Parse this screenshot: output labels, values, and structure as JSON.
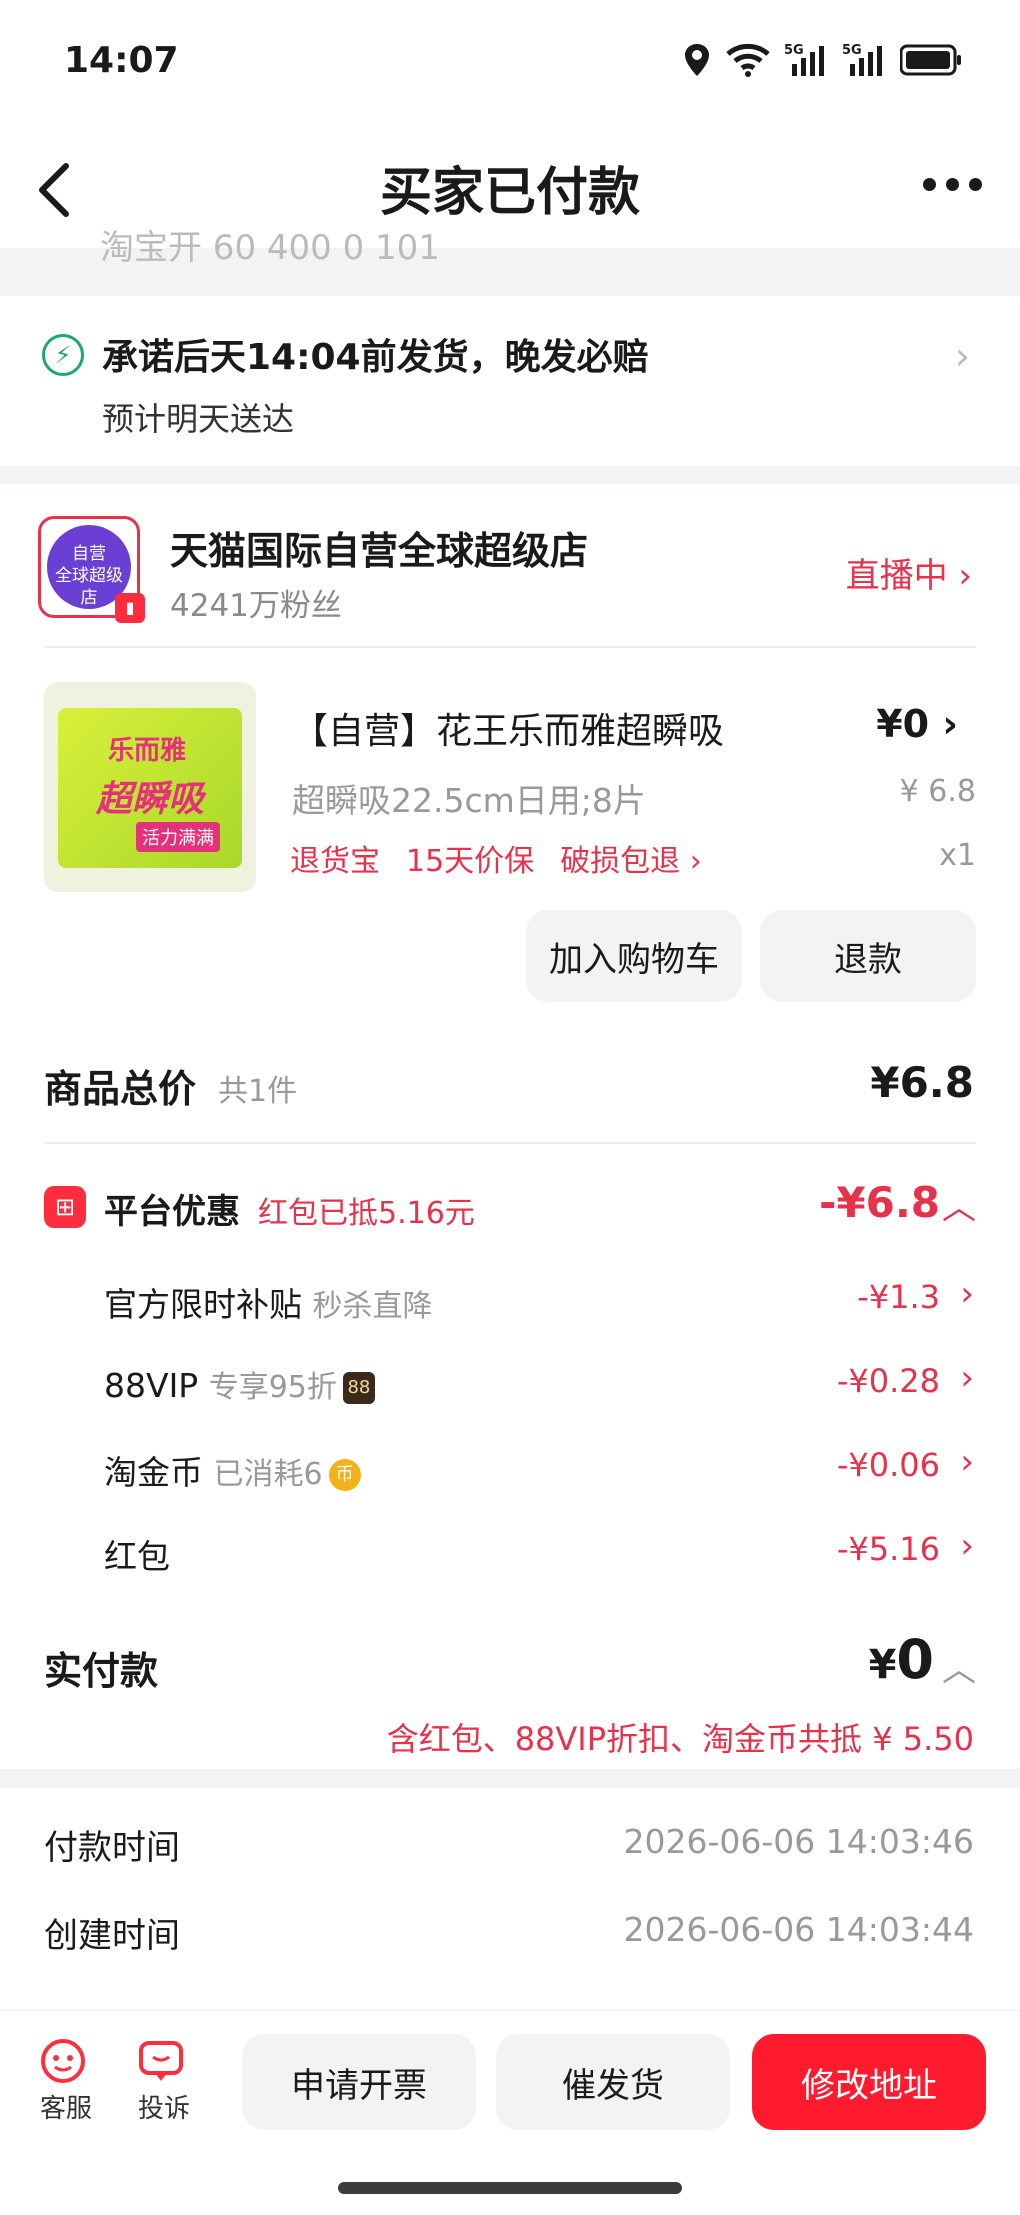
{
  "status_bar": {
    "time": "14:07"
  },
  "nav": {
    "title": "买家已付款"
  },
  "faded_header": "淘宝开 60 400    0 101",
  "shipping": {
    "title": "承诺后天14:04前发货，晚发必赔",
    "subtitle": "预计明天送达"
  },
  "shop": {
    "logo_line1": "自营",
    "logo_line2": "全球超级店",
    "name": "天猫国际自营全球超级店",
    "fans": "4241万粉丝",
    "live": "直播中"
  },
  "product": {
    "pkg_brand": "乐而雅",
    "pkg_name": "超瞬吸",
    "pkg_tag": "活力满满",
    "title": "【自营】花王乐而雅超瞬吸",
    "price": "¥0",
    "spec": "超瞬吸22.5cm日用;8片",
    "original_price": "¥ 6.8",
    "tags": [
      "退货宝",
      "15天价保",
      "破损包退"
    ],
    "qty": "x1",
    "btn_cart": "加入购物车",
    "btn_refund": "退款"
  },
  "summary": {
    "total_label": "商品总价",
    "total_count": "共1件",
    "total_value": "¥6.8",
    "promo_label": "平台优惠",
    "promo_sub": "红包已抵5.16元",
    "promo_value": "-¥6.8",
    "discounts": [
      {
        "label": "官方限时补贴",
        "note": "秒杀直降",
        "value": "-¥1.3",
        "badge": ""
      },
      {
        "label": "88VIP",
        "note": "专享95折",
        "value": "-¥0.28",
        "badge": "88"
      },
      {
        "label": "淘金币",
        "note": "已消耗6",
        "value": "-¥0.06",
        "badge": "币"
      },
      {
        "label": "红包",
        "note": "",
        "value": "-¥5.16",
        "badge": ""
      }
    ],
    "paid_label": "实付款",
    "paid_currency": "¥",
    "paid_value": "0",
    "paid_note": "含红包、88VIP折扣、淘金币共抵 ¥ 5.50"
  },
  "info": {
    "pay_time_label": "付款时间",
    "pay_time": "2026-06-06 14:03:46",
    "create_time_label": "创建时间",
    "create_time": "2026-06-06 14:03:44"
  },
  "bottom_bar": {
    "service": "客服",
    "complaint": "投诉",
    "invoice": "申请开票",
    "urge": "催发货",
    "modify_address": "修改地址"
  },
  "colors": {
    "accent_red": "#e8324b",
    "primary_button": "#ff1a2e",
    "success_green": "#19a974"
  }
}
